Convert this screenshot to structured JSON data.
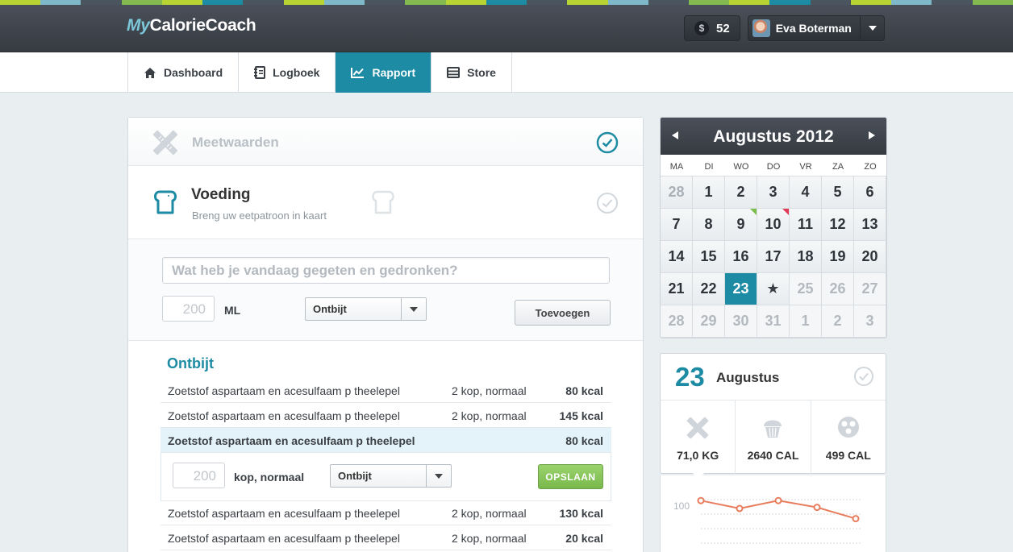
{
  "strip_colors": [
    "#b8d432",
    "#7fb8c9",
    "#4a5560",
    "#83b94f",
    "#b8d432",
    "#1d8ba3",
    "#4a5560",
    "#b8d432",
    "#7fb8c9",
    "#4a5560",
    "#83b94f",
    "#b8d432",
    "#1d8ba3",
    "#4a5560",
    "#b8d432",
    "#7fb8c9",
    "#4a5560",
    "#83b94f",
    "#b8d432",
    "#1d8ba3",
    "#4a5560",
    "#b8d432",
    "#7fb8c9",
    "#4a5560",
    "#83b94f"
  ],
  "header": {
    "logo_prefix": "My",
    "logo_rest": "CalorieCoach",
    "coin_symbol": "$",
    "coins": "52",
    "user_name": "Eva Boterman"
  },
  "nav": {
    "tabs": [
      {
        "label": "Dashboard",
        "icon": "home-icon"
      },
      {
        "label": "Logboek",
        "icon": "notebook-icon"
      },
      {
        "label": "Rapport",
        "icon": "chart-icon",
        "active": true
      },
      {
        "label": "Store",
        "icon": "store-icon"
      }
    ]
  },
  "main": {
    "meetwaarden": "Meetwaarden",
    "voeding_title": "Voeding",
    "voeding_sub": "Breng uw eetpatroon in kaart",
    "search_placeholder": "Wat heb je vandaag gegeten en gedronken?",
    "qty_value": "200",
    "qty_unit": "ML",
    "meal_select": "Ontbijt",
    "add_button": "Toevoegen",
    "meal_title": "Ontbijt",
    "rows": [
      {
        "name": "Zoetstof aspartaam en acesulfaam p theelepel",
        "amount": "2 kop, normaal",
        "kcal": "80 kcal"
      },
      {
        "name": "Zoetstof aspartaam en acesulfaam p theelepel",
        "amount": "2 kop, normaal",
        "kcal": "145 kcal"
      },
      {
        "name": "Zoetstof aspartaam en acesulfaam p theelepel",
        "amount": "",
        "kcal": "80 kcal"
      },
      {
        "name": "Zoetstof aspartaam en acesulfaam p theelepel",
        "amount": "2 kop, normaal",
        "kcal": "130 kcal"
      },
      {
        "name": "Zoetstof aspartaam en acesulfaam p theelepel",
        "amount": "2 kop, normaal",
        "kcal": "20 kcal"
      }
    ],
    "edit": {
      "qty": "200",
      "unit": "kop, normaal",
      "meal": "Ontbijt",
      "save": "OPSLAAN"
    }
  },
  "calendar": {
    "month": "Augustus 2012",
    "dows": [
      "MA",
      "DI",
      "WO",
      "DO",
      "VR",
      "ZA",
      "ZO"
    ],
    "weeks": [
      [
        "28",
        "1",
        "2",
        "3",
        "4",
        "5",
        "6"
      ],
      [
        "7",
        "8",
        "9",
        "10",
        "11",
        "12",
        "13"
      ],
      [
        "14",
        "15",
        "16",
        "17",
        "18",
        "19",
        "20"
      ],
      [
        "21",
        "22",
        "23",
        "★",
        "25",
        "26",
        "27"
      ],
      [
        "28",
        "29",
        "30",
        "31",
        "1",
        "2",
        "3"
      ]
    ]
  },
  "day": {
    "number": "23",
    "month": "Augustus",
    "stats": [
      {
        "icon": "scale-icon",
        "value": "71,0 KG"
      },
      {
        "icon": "muffin-icon",
        "value": "2640 CAL"
      },
      {
        "icon": "burn-icon",
        "value": "499 CAL"
      }
    ]
  },
  "chart_data": {
    "type": "line",
    "y_tick_labels": [
      "100"
    ],
    "values": [
      52,
      45,
      52,
      46,
      36
    ],
    "color": "#e87d5e"
  }
}
